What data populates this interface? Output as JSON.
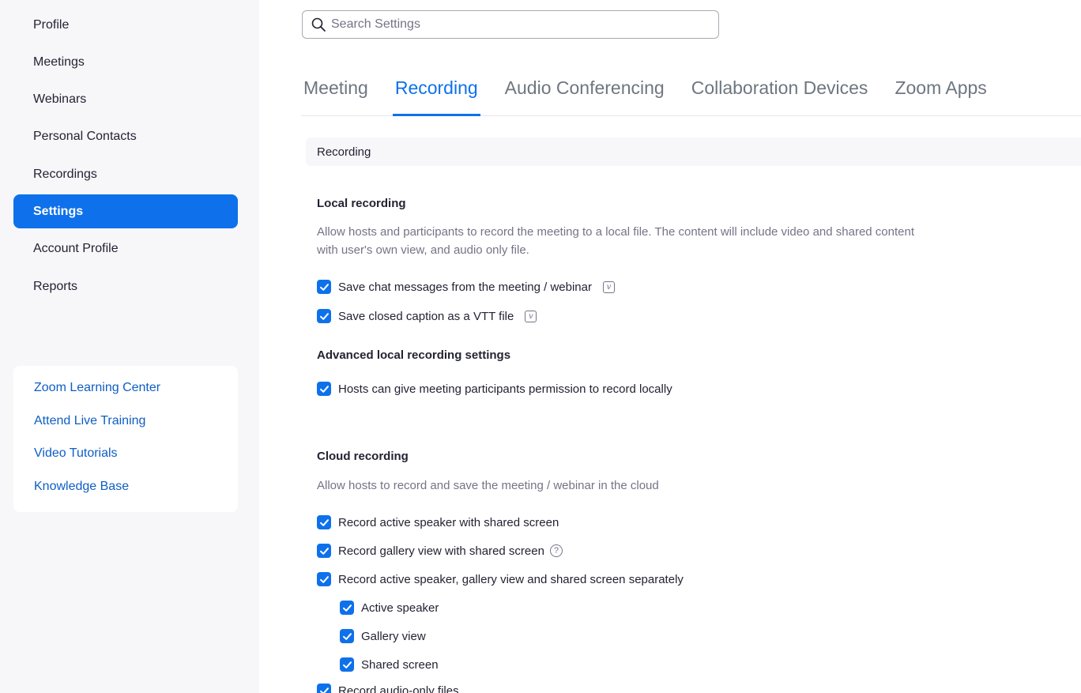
{
  "sidebar": {
    "nav": [
      {
        "label": "Profile"
      },
      {
        "label": "Meetings"
      },
      {
        "label": "Webinars"
      },
      {
        "label": "Personal Contacts"
      },
      {
        "label": "Recordings"
      },
      {
        "label": "Settings",
        "active": true
      },
      {
        "label": "Account Profile"
      },
      {
        "label": "Reports"
      }
    ],
    "help_links": [
      {
        "label": "Zoom Learning Center"
      },
      {
        "label": "Attend Live Training"
      },
      {
        "label": "Video Tutorials"
      },
      {
        "label": "Knowledge Base"
      }
    ]
  },
  "search": {
    "placeholder": "Search Settings",
    "value": ""
  },
  "tabs": [
    {
      "label": "Meeting"
    },
    {
      "label": "Recording",
      "active": true
    },
    {
      "label": "Audio Conferencing"
    },
    {
      "label": "Collaboration Devices"
    },
    {
      "label": "Zoom Apps"
    }
  ],
  "section_title": "Recording",
  "local_recording": {
    "title": "Local recording",
    "description": "Allow hosts and participants to record the meeting to a local file. The content will include video and shared content with user's own view, and audio only file.",
    "options": [
      {
        "label": "Save chat messages from the meeting / webinar",
        "checked": true,
        "badge": "v"
      },
      {
        "label": "Save closed caption as a VTT file",
        "checked": true,
        "badge": "v"
      }
    ],
    "advanced_title": "Advanced local recording settings",
    "advanced_options": [
      {
        "label": "Hosts can give meeting participants permission to record locally",
        "checked": true
      }
    ]
  },
  "cloud_recording": {
    "title": "Cloud recording",
    "description": "Allow hosts to record and save the meeting / webinar in the cloud",
    "options": [
      {
        "label": "Record active speaker with shared screen",
        "checked": true
      },
      {
        "label": "Record gallery view with shared screen",
        "checked": true,
        "help": "?"
      },
      {
        "label": "Record active speaker, gallery view and shared screen separately",
        "checked": true
      }
    ],
    "sub_options": [
      {
        "label": "Active speaker",
        "checked": true
      },
      {
        "label": "Gallery view",
        "checked": true
      },
      {
        "label": "Shared screen",
        "checked": true
      }
    ],
    "more_options": [
      {
        "label": "Record audio-only files",
        "checked": true
      }
    ]
  },
  "colors": {
    "accent": "#0e71eb",
    "sidebar_bg": "#f7f7fa",
    "link": "#0e5ec4"
  }
}
